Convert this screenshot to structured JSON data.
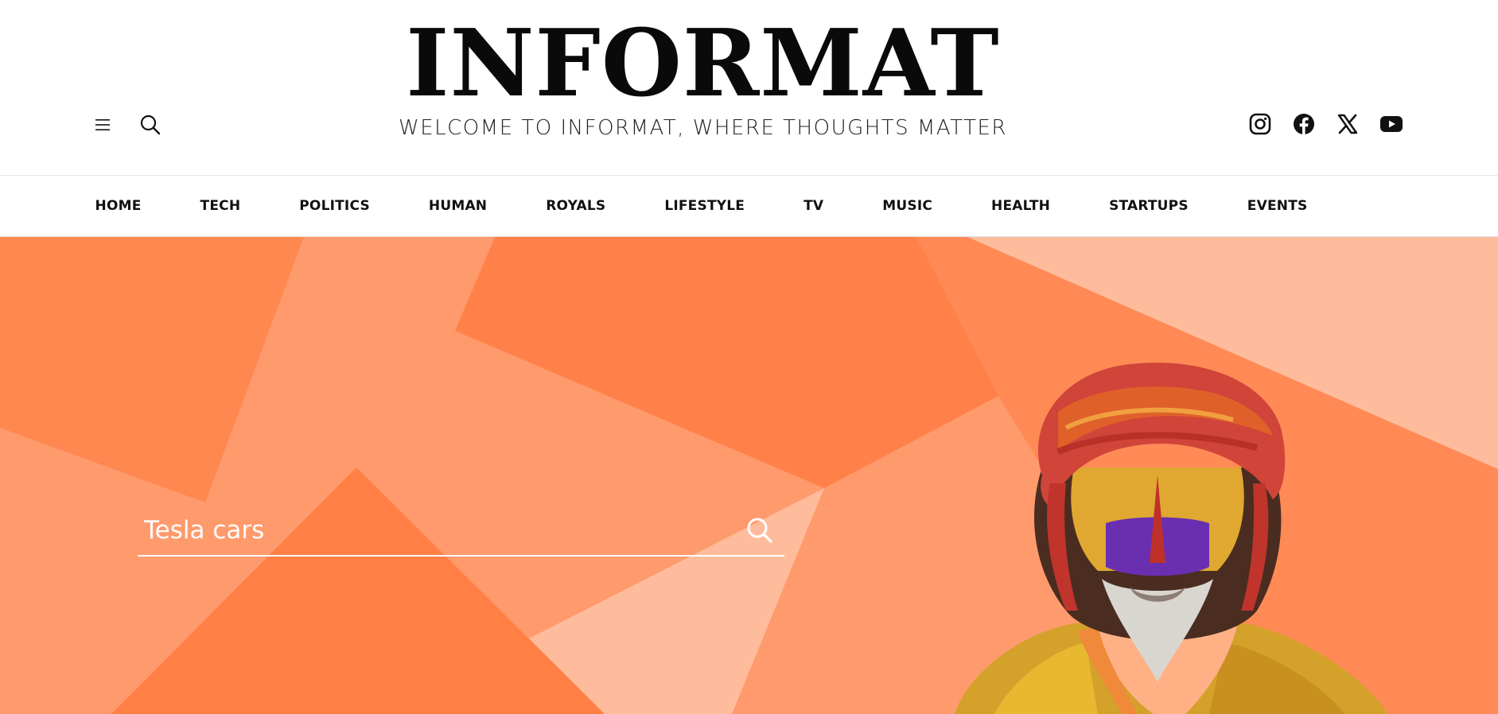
{
  "site": {
    "logo": "INFORMAT",
    "tagline": "WELCOME TO INFORMAT, WHERE THOUGHTS MATTER"
  },
  "tools": {
    "menu_icon": "hamburger-icon",
    "search_icon": "search-icon"
  },
  "social": [
    "instagram-icon",
    "facebook-icon",
    "x-icon",
    "youtube-icon"
  ],
  "nav": {
    "items": [
      {
        "label": "HOME"
      },
      {
        "label": "TECH"
      },
      {
        "label": "POLITICS"
      },
      {
        "label": "HUMAN"
      },
      {
        "label": "ROYALS"
      },
      {
        "label": "LIFESTYLE"
      },
      {
        "label": "TV"
      },
      {
        "label": "MUSIC"
      },
      {
        "label": "HEALTH"
      },
      {
        "label": "STARTUPS"
      },
      {
        "label": "EVENTS"
      }
    ]
  },
  "hero": {
    "search_value": "Tesla cars"
  },
  "colors": {
    "hero_base": "#ff9a6c",
    "hero_dark": "#ff7f45",
    "hero_light": "#ffbc9c",
    "text": "#111111"
  }
}
